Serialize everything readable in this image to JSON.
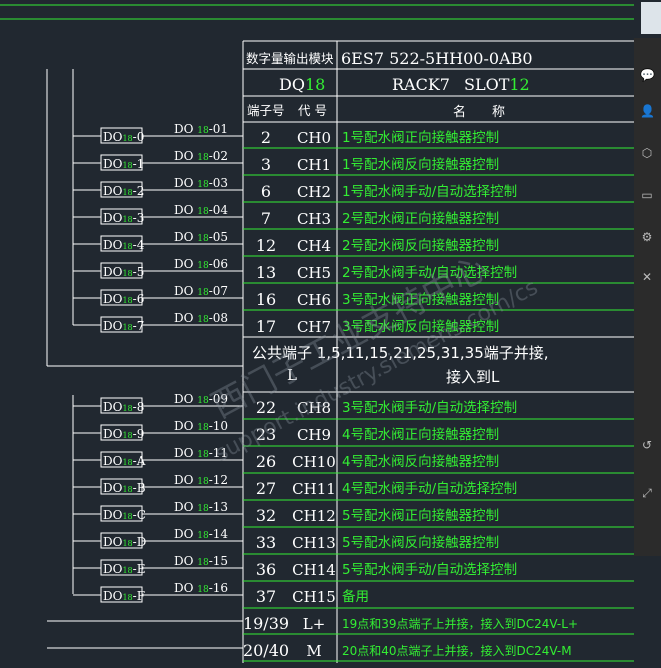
{
  "header": {
    "module_label": "数字量输出模块",
    "part_number": "6ES7 522-5HH00-0AB0",
    "dq_prefix": "DQ",
    "dq_number": "18",
    "rack": "RACK7",
    "slot_prefix": "SLOT",
    "slot_number": "12",
    "col_terminal": "端子号",
    "col_code": "代 号",
    "col_name": "名　　称"
  },
  "rows_top": [
    {
      "terminal": "2",
      "code": "CH0",
      "name": "1号配水阀正向接触器控制",
      "signal": "DO18-01",
      "block": "DO18-0"
    },
    {
      "terminal": "3",
      "code": "CH1",
      "name": "1号配水阀反向接触器控制",
      "signal": "DO18-02",
      "block": "DO18-1"
    },
    {
      "terminal": "6",
      "code": "CH2",
      "name": "1号配水阀手动/自动选择控制",
      "signal": "DO18-03",
      "block": "DO18-2"
    },
    {
      "terminal": "7",
      "code": "CH3",
      "name": "2号配水阀正向接触器控制",
      "signal": "DO18-04",
      "block": "DO18-3"
    },
    {
      "terminal": "12",
      "code": "CH4",
      "name": "2号配水阀反向接触器控制",
      "signal": "DO18-05",
      "block": "DO18-4"
    },
    {
      "terminal": "13",
      "code": "CH5",
      "name": "2号配水阀手动/自动选择控制",
      "signal": "DO18-06",
      "block": "DO18-5"
    },
    {
      "terminal": "16",
      "code": "CH6",
      "name": "3号配水阀正向接触器控制",
      "signal": "DO18-07",
      "block": "DO18-6"
    },
    {
      "terminal": "17",
      "code": "CH7",
      "name": "3号配水阀反向接触器控制",
      "signal": "DO18-08",
      "block": "DO18-7"
    }
  ],
  "common": {
    "line1": "公共端子 1,5,11,15,21,25,31,35端子并接,",
    "line2": "接入到L",
    "marker": "L"
  },
  "rows_bottom": [
    {
      "terminal": "22",
      "code": "CH8",
      "name": "3号配水阀手动/自动选择控制",
      "signal": "DO18-09",
      "block": "DO18-8"
    },
    {
      "terminal": "23",
      "code": "CH9",
      "name": "4号配水阀正向接触器控制",
      "signal": "DO18-10",
      "block": "DO18-9"
    },
    {
      "terminal": "26",
      "code": "CH10",
      "name": "4号配水阀反向接触器控制",
      "signal": "DO18-11",
      "block": "DO18-A"
    },
    {
      "terminal": "27",
      "code": "CH11",
      "name": "4号配水阀手动/自动选择控制",
      "signal": "DO18-12",
      "block": "DO18-B"
    },
    {
      "terminal": "32",
      "code": "CH12",
      "name": "5号配水阀正向接触器控制",
      "signal": "DO18-13",
      "block": "DO18-C"
    },
    {
      "terminal": "33",
      "code": "CH13",
      "name": "5号配水阀反向接触器控制",
      "signal": "DO18-14",
      "block": "DO18-D"
    },
    {
      "terminal": "36",
      "code": "CH14",
      "name": "5号配水阀手动/自动选择控制",
      "signal": "DO18-15",
      "block": "DO18-E"
    },
    {
      "terminal": "37",
      "code": "CH15",
      "name": "备用",
      "signal": "DO18-16",
      "block": "DO18-F"
    }
  ],
  "rows_power": [
    {
      "terminal": "19/39",
      "code": "L+",
      "name": "19点和39点端子上并接，接入到DC24V-L+"
    },
    {
      "terminal": "20/40",
      "code": "M",
      "name": "20点和40点端子上并接，接入到DC24V-M"
    }
  ],
  "watermark": {
    "line1": "西门子工业支持中心",
    "line2": "support.industry.siemens.com/cs"
  },
  "colors": {
    "background": "#212830",
    "line_green": "#33ee33",
    "text_white": "#ffffff",
    "text_green": "#33ee33"
  },
  "toolbar_icons": [
    "chat-icon",
    "user-icon",
    "cube-icon",
    "folder-icon",
    "settings-icon",
    "share-icon",
    "link-icon",
    "expand-icon"
  ]
}
